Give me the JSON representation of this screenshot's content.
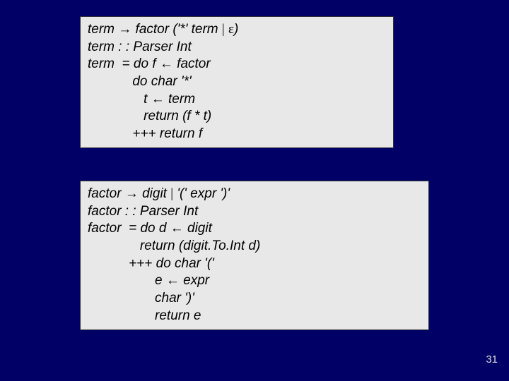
{
  "box1": {
    "line1_a": "term ",
    "line1_arrow": "→",
    "line1_b": " factor ('*' term ",
    "line1_bar": "|",
    "line1_c": " ",
    "line1_eps": "ε",
    "line1_d": ")",
    "line2": "term : : Parser Int",
    "line3_a": "term  = do f ",
    "line3_arrow": "←",
    "line3_b": " factor",
    "line4": "            do char '*'",
    "line5_a": "               t ",
    "line5_arrow": "←",
    "line5_b": " term",
    "line6": "               return (f * t)",
    "line7": "            +++ return f"
  },
  "box2": {
    "line1_a": "factor ",
    "line1_arrow": "→",
    "line1_b": " digit ",
    "line1_bar": "|",
    "line1_c": " '(' expr ')'",
    "line2": "factor : : Parser Int",
    "line3_a": "factor  = do d ",
    "line3_arrow": "←",
    "line3_b": " digit",
    "line4": "              return (digit.To.Int d)",
    "line5": "           +++ do char '('",
    "line6_a": "                  e ",
    "line6_arrow": "←",
    "line6_b": " expr",
    "line7": "                  char ')'",
    "line8": "                  return e"
  },
  "page_number": "31"
}
